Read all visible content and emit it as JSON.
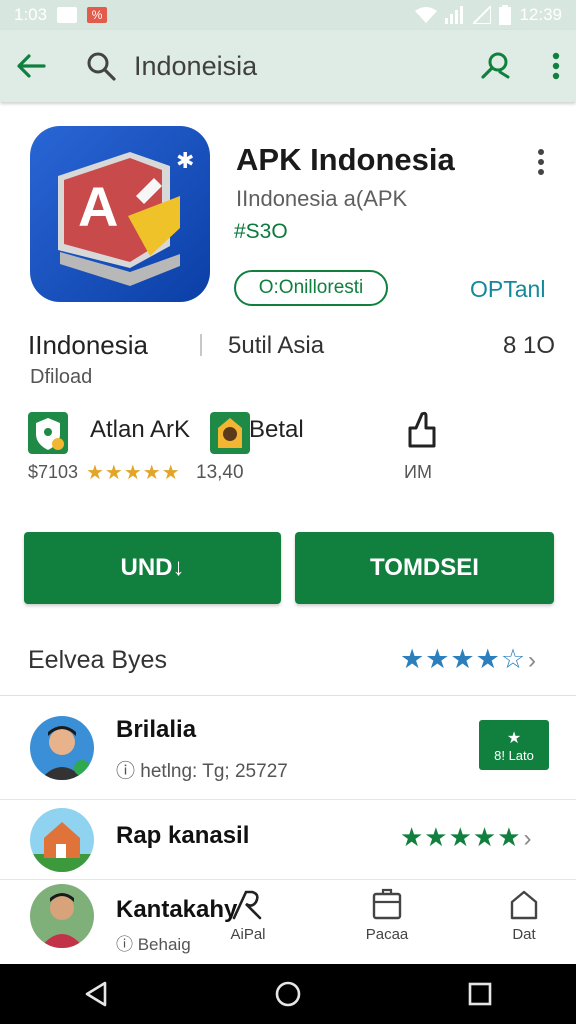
{
  "status_bar": {
    "time_left": "1:03",
    "time_right": "12:39",
    "notif_label": "%"
  },
  "search": {
    "query": "Indoneisia"
  },
  "app": {
    "title": "APK Indonesia",
    "subtitle": "IIndonesia a(APK",
    "price": "#S3O",
    "chip": "O:Onilloresti",
    "link": "OPTanl"
  },
  "info": {
    "k1": "IIndonesia",
    "k1_sub": "Dfiload",
    "k2": "5util Asia",
    "k3": "8 1O"
  },
  "badges": {
    "label1": "Atlan ArK",
    "label2": "Betal",
    "sub1": "$7103",
    "stars": "★★★★★",
    "sub2": "13,40",
    "sub3": "ИM"
  },
  "buttons": {
    "left": "UND↓",
    "right": "TOMDSEI"
  },
  "reviews": {
    "title": "Eelvea Byes",
    "stars": "★★★★☆",
    "chevron": "›"
  },
  "list": [
    {
      "title": "Brilalia",
      "sub": "ⓘ hetlng: Tg; 25727",
      "badge_icon": "★",
      "badge_text": "8! Lato"
    },
    {
      "title": "Rap kanasil",
      "stars": "★★★★★",
      "chevron": "›"
    },
    {
      "title": "Kantakahy",
      "sub": "ⓘ Behaig"
    }
  ],
  "bottom_tabs": [
    {
      "label": "AiPal"
    },
    {
      "label": "Pacaa"
    },
    {
      "label": "Dat"
    }
  ],
  "colors": {
    "primary_green": "#11803f",
    "link_teal": "#13899a",
    "star_blue": "#2b7fbd",
    "star_gold": "#e2a528"
  }
}
